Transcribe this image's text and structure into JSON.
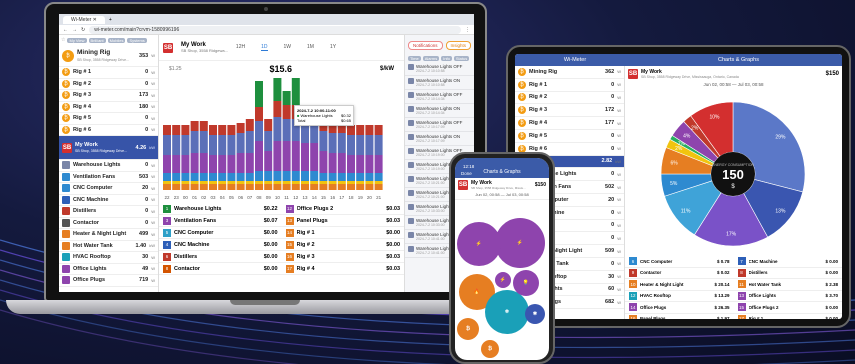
{
  "laptop": {
    "tab_title": "Wi-Meter",
    "url": "wi-meter.com/main?crvm-1580996196",
    "side_chips": [
      "My View",
      "Brilliant",
      "Mobiles",
      "Systems"
    ],
    "side_items": [
      {
        "name": "Mining Rig",
        "sub": "SB Shop, 3558 Ridgeway Drive...",
        "value": "353",
        "unit": "W",
        "big": true
      },
      {
        "name": "Rig # 1",
        "value": "0",
        "unit": "W"
      },
      {
        "name": "Rig # 2",
        "value": "0",
        "unit": "W"
      },
      {
        "name": "Rig # 3",
        "value": "173",
        "unit": "W"
      },
      {
        "name": "Rig # 4",
        "value": "180",
        "unit": "W"
      },
      {
        "name": "Rig # 5",
        "value": "0",
        "unit": "W"
      },
      {
        "name": "Rig # 6",
        "value": "0",
        "unit": "W"
      }
    ],
    "selected": {
      "name": "My Work",
      "sub": "SB Shop, 3558 Ridgeway Drive...",
      "value": "4.26",
      "unit": "kW"
    },
    "work_items": [
      {
        "name": "Warehouse Lights",
        "value": "0",
        "unit": "W"
      },
      {
        "name": "Ventilation Fans",
        "value": "503",
        "unit": "W"
      },
      {
        "name": "CNC Computer",
        "value": "20",
        "unit": "W"
      },
      {
        "name": "CNC Machine",
        "value": "0",
        "unit": "W"
      },
      {
        "name": "Distillers",
        "value": "0",
        "unit": "W"
      },
      {
        "name": "Contactor",
        "value": "0",
        "unit": "W"
      },
      {
        "name": "Heater & Night Light",
        "value": "499",
        "unit": "W"
      },
      {
        "name": "Hot Water Tank",
        "value": "1.40",
        "unit": "kW"
      },
      {
        "name": "HVAC Rooftop",
        "value": "30",
        "unit": "W"
      },
      {
        "name": "Office Lights",
        "value": "49",
        "unit": "W"
      },
      {
        "name": "Office Plugs",
        "value": "719",
        "unit": "W"
      }
    ],
    "main_title": "My Work",
    "main_sub": "SB Shop, 3558 Ridgewa...",
    "period_tabs": [
      "12H",
      "1D",
      "1W",
      "1M",
      "1Y"
    ],
    "active_tab": "1D",
    "dates": [
      "Jul 01, 22:06",
      "Jul 02, 22:06"
    ],
    "left_val": "$1.25",
    "cost": "$15.6",
    "rate_unit": "$/kW",
    "tooltip": {
      "time": "2024-7-2 10:00-11:00",
      "rows": [
        {
          "name": "Warehouse Lights",
          "val": "$0.32"
        },
        {
          "name": "Total",
          "val": "$0.65"
        }
      ]
    },
    "legend_left": [
      {
        "n": "1",
        "name": "Warehouse Lights",
        "val": "$0.22",
        "color": "#1e8f3e"
      },
      {
        "n": "3",
        "name": "Ventilation Fans",
        "val": "$0.07",
        "color": "#8e44ad"
      },
      {
        "n": "5",
        "name": "CNC Computer",
        "val": "$0.00",
        "color": "#2ea0c8"
      },
      {
        "n": "4",
        "name": "CNC Machine",
        "val": "$0.00",
        "color": "#2d5fb8"
      },
      {
        "n": "6",
        "name": "Distillers",
        "val": "$0.00",
        "color": "#c0392b"
      },
      {
        "n": "8",
        "name": "Contactor",
        "val": "$0.00",
        "color": "#d35400"
      }
    ],
    "legend_right": [
      {
        "n": "12",
        "name": "Office Plugs 2",
        "val": "$0.03",
        "color": "#8e44ad"
      },
      {
        "n": "13",
        "name": "Panel Plugs",
        "val": "$0.03",
        "color": "#e67e22"
      },
      {
        "n": "14",
        "name": "Rig # 1",
        "val": "$0.00",
        "color": "#e67e22"
      },
      {
        "n": "15",
        "name": "Rig # 2",
        "val": "$0.00",
        "color": "#e67e22"
      },
      {
        "n": "16",
        "name": "Rig # 3",
        "val": "$0.03",
        "color": "#e67e22"
      },
      {
        "n": "17",
        "name": "Rig # 4",
        "val": "$0.03",
        "color": "#e67e22"
      }
    ],
    "right_buttons": [
      "Notifications",
      "Insights"
    ],
    "right_filters": [
      "Time",
      "Alarms",
      "Info",
      "Status"
    ],
    "events": [
      {
        "tx": "Warehouse Lights OFF",
        "ts": "2024-7-2 10:10:58"
      },
      {
        "tx": "Warehouse Lights ON",
        "ts": "2024-7-2 10:10:58"
      },
      {
        "tx": "Warehouse Lights OFF",
        "ts": "2024-7-2 10:14:34"
      },
      {
        "tx": "Warehouse Lights ON",
        "ts": "2024-7-2 10:14:34"
      },
      {
        "tx": "Warehouse Lights OFF",
        "ts": "2024-7-2 10:17:09"
      },
      {
        "tx": "Warehouse Lights ON",
        "ts": "2024-7-2 10:17:09"
      },
      {
        "tx": "Warehouse Lights OFF",
        "ts": "2024-7-2 10:19:00"
      },
      {
        "tx": "Warehouse Lights ON",
        "ts": "2024-7-2 10:19:00"
      },
      {
        "tx": "Warehouse Lights OFF",
        "ts": "2024-7-2 10:21:00"
      },
      {
        "tx": "Warehouse Lights ON",
        "ts": "2024-7-2 10:21:00"
      },
      {
        "tx": "Warehouse Lights OFF",
        "ts": "2024-7-2 10:33:00"
      },
      {
        "tx": "Warehouse Lights ON",
        "ts": "2024-7-2 10:33:00"
      },
      {
        "tx": "Warehouse Lights OFF",
        "ts": "2024-7-2 10:41:00"
      },
      {
        "tx": "Warehouse Lights ON",
        "ts": "2024-7-2 10:41:00"
      }
    ],
    "hours": [
      "22",
      "23",
      "00",
      "01",
      "02",
      "03",
      "04",
      "05",
      "06",
      "07",
      "08",
      "09",
      "10",
      "11",
      "12",
      "13",
      "14",
      "15",
      "16",
      "17",
      "18",
      "19",
      "20",
      "21"
    ]
  },
  "tablet": {
    "left_title": "Wi-Meter",
    "right_title": "Charts & Graphs",
    "items": [
      {
        "name": "Mining Rig",
        "value": "362",
        "unit": "W"
      },
      {
        "name": "Rig # 1",
        "value": "0",
        "unit": "W"
      },
      {
        "name": "Rig # 2",
        "value": "0",
        "unit": "W"
      },
      {
        "name": "Rig # 3",
        "value": "172",
        "unit": "W"
      },
      {
        "name": "Rig # 4",
        "value": "177",
        "unit": "W"
      },
      {
        "name": "Rig # 5",
        "value": "0",
        "unit": "W"
      },
      {
        "name": "Rig # 6",
        "value": "0",
        "unit": "W"
      },
      {
        "name": "My Work",
        "value": "2.82",
        "unit": "kW"
      },
      {
        "name": "Warehouse Lights",
        "value": "0",
        "unit": "W"
      },
      {
        "name": "Ventilation Fans",
        "value": "502",
        "unit": "W"
      },
      {
        "name": "CNC Computer",
        "value": "20",
        "unit": "W"
      },
      {
        "name": "CNC Machine",
        "value": "0",
        "unit": "W"
      },
      {
        "name": "Distillers",
        "value": "0",
        "unit": "W"
      },
      {
        "name": "Contactor",
        "value": "0",
        "unit": "W"
      },
      {
        "name": "Heater & Night Light",
        "value": "509",
        "unit": "W"
      },
      {
        "name": "Hot Water Tank",
        "value": "0",
        "unit": "W"
      },
      {
        "name": "HVAC Rooftop",
        "value": "30",
        "unit": "W"
      },
      {
        "name": "Office Lights",
        "value": "60",
        "unit": "W"
      },
      {
        "name": "Office Plugs",
        "value": "682",
        "unit": "W"
      }
    ],
    "work_title": "My Work",
    "work_sub": "SB Shop, 3558 Ridgeway Drive, Mississauga, Ontario, Canada",
    "work_value": "150",
    "dates": "Jun 02, 00:58 — Jul 03, 00:58",
    "donut_center": "150",
    "donut_label": "$",
    "donut_caption": "ENERGY CONSUMPTION",
    "slices": [
      {
        "label": "29%",
        "value": 29,
        "color": "#5b78c8"
      },
      {
        "label": "13%",
        "value": 13,
        "color": "#3a56b0"
      },
      {
        "label": "17%",
        "value": 17,
        "color": "#7a52c8"
      },
      {
        "label": "11%",
        "value": 11,
        "color": "#3fa3d8"
      },
      {
        "label": "5%",
        "value": 5,
        "color": "#2e8ad0"
      },
      {
        "label": "6%",
        "value": 6,
        "color": "#e67e22"
      },
      {
        "label": "2%",
        "value": 2,
        "color": "#f1c40f"
      },
      {
        "label": "1%",
        "value": 1,
        "color": "#27ae60"
      },
      {
        "label": "4%",
        "value": 4,
        "color": "#8e44ad"
      },
      {
        "label": "2%",
        "value": 2,
        "color": "#c0392b"
      },
      {
        "label": "10%",
        "value": 10,
        "color": "#d32f2f"
      }
    ],
    "table": [
      {
        "n": "6",
        "a": "CNC Computer",
        "av": "$ 0.78",
        "m": "7",
        "b": "CNC Machine",
        "bv": "$ 0.00"
      },
      {
        "n": "9",
        "a": "Contactor",
        "av": "$ 0.02",
        "m": "8",
        "b": "Distillers",
        "bv": "$ 0.00"
      },
      {
        "n": "10",
        "a": "Heater & Night Light",
        "av": "$ 20.14",
        "m": "11",
        "b": "Hot Water Tank",
        "bv": "$ 2.38"
      },
      {
        "n": "12",
        "a": "HVAC Rooftop",
        "av": "$ 13.29",
        "m": "13",
        "b": "Office Lights",
        "bv": "$ 3.70"
      },
      {
        "n": "14",
        "a": "Office Plugs",
        "av": "$ 26.35",
        "m": "15",
        "b": "Office Plugs 2",
        "av2": "",
        "bv": "$ 0.00"
      },
      {
        "n": "16",
        "a": "Panel Plugs",
        "av": "$ 1.97",
        "m": "17",
        "b": "Rig # 1",
        "bv": "$ 0.00"
      }
    ]
  },
  "phone": {
    "time": "12:18",
    "title": "Charts & Graphs",
    "back": "Done",
    "work_title": "My Work",
    "work_sub": "SB Shop, 3558 Ridgeway Drive, Missis...",
    "work_value": "150",
    "dates": "Jun 02, 00:58 — Jul 03, 00:58"
  },
  "colors": {
    "brand": "#3b5ba8",
    "accent": "#d32f2f",
    "orange": "#f39c12"
  }
}
